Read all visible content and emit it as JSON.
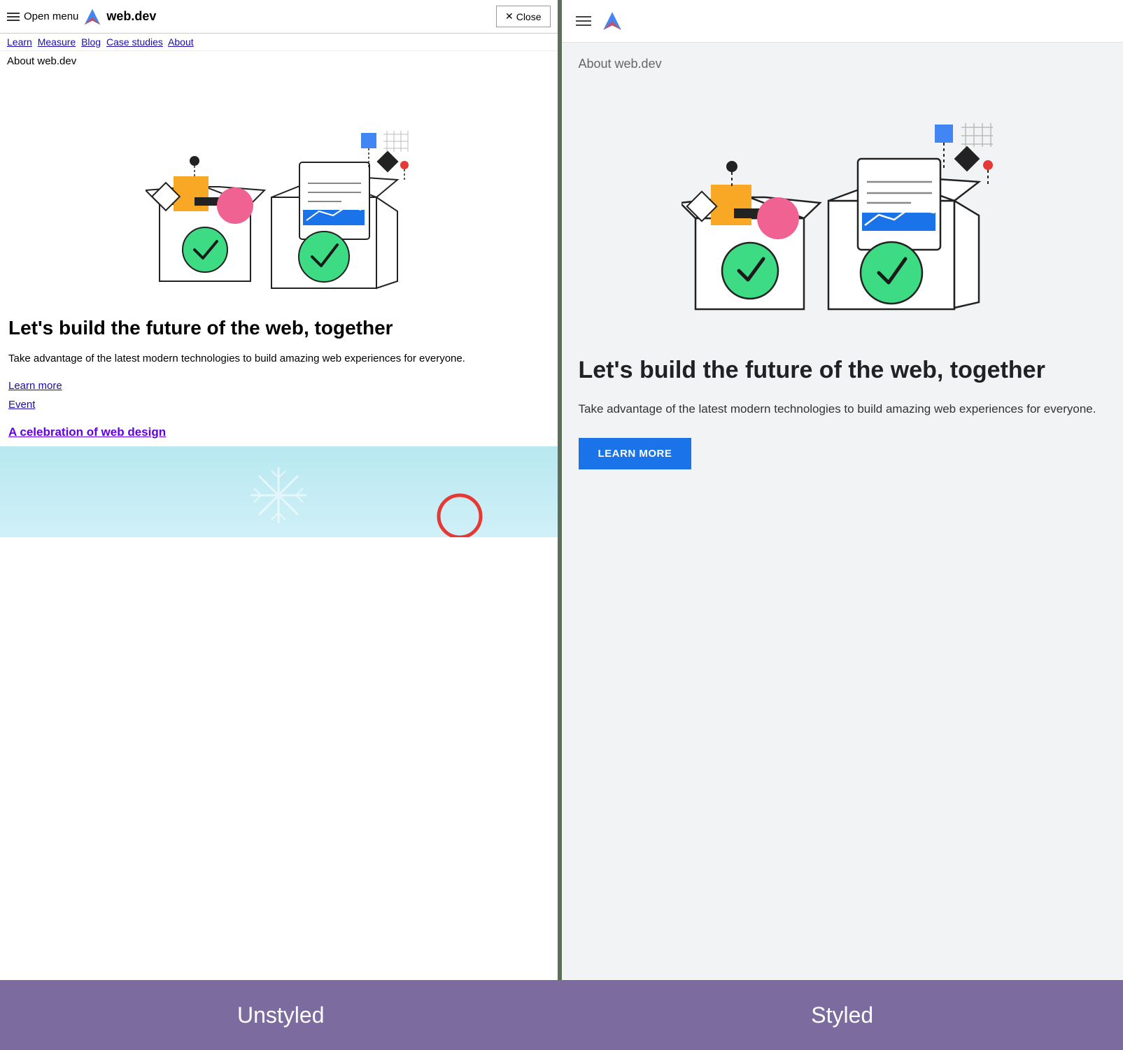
{
  "site": {
    "name": "web.dev",
    "logo_icon": "arrow-icon"
  },
  "left_panel": {
    "label": "Unstyled",
    "header": {
      "menu_label": "Open menu",
      "close_label": "Close"
    },
    "nav": {
      "links": [
        "Learn",
        "Measure",
        "Blog",
        "Case studies",
        "About"
      ]
    },
    "page_label": "About web.dev",
    "heading": "Let's build the future of the web, together",
    "description": "Take advantage of the latest modern technologies to build amazing web experiences for everyone.",
    "links": [
      {
        "text": "Learn more",
        "href": "#"
      },
      {
        "text": "Event",
        "href": "#"
      }
    ],
    "event_link": {
      "text": "A celebration of web design",
      "href": "#"
    }
  },
  "right_panel": {
    "label": "Styled",
    "page_label": "About web.dev",
    "heading": "Let's build the future of the web, together",
    "description": "Take advantage of the latest modern technologies to build amazing web experiences for everyone.",
    "cta_button": "LEARN MORE"
  },
  "colors": {
    "link": "#1a0dab",
    "event_link": "#6200ea",
    "cta_bg": "#1a73e8",
    "label_bg": "#7b6b9e",
    "panel_bg_styled": "#f1f3f4"
  }
}
